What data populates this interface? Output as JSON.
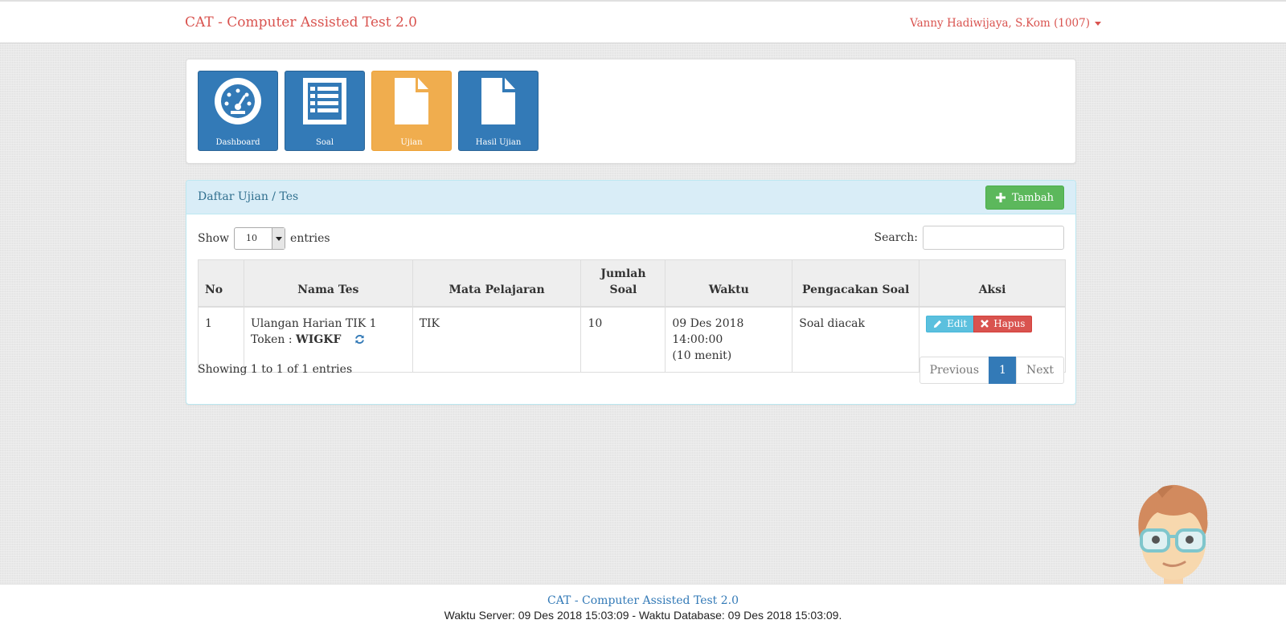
{
  "navbar": {
    "brand": "CAT - Computer Assisted Test 2.0",
    "user": "Vanny Hadiwijaya, S.Kom (1007)"
  },
  "menu": {
    "tiles": [
      {
        "label": "Dashboard",
        "icon": "dashboard-gauge-icon",
        "color": "#337ab7"
      },
      {
        "label": "Soal",
        "icon": "list-icon",
        "color": "#337ab7"
      },
      {
        "label": "Ujian",
        "icon": "file-icon",
        "color": "#f0ad4e",
        "active": true
      },
      {
        "label": "Hasil Ujian",
        "icon": "file-icon",
        "color": "#337ab7"
      }
    ]
  },
  "list_panel": {
    "title": "Daftar Ujian / Tes",
    "add_button": "Tambah",
    "show_label": "Show",
    "entries_value": "10",
    "entries_label": "entries",
    "search_label": "Search:",
    "search_value": "",
    "columns": [
      "No",
      "Nama Tes",
      "Mata Pelajaran",
      "Jumlah Soal",
      "Waktu",
      "Pengacakan Soal",
      "Aksi"
    ],
    "rows": [
      {
        "no": "1",
        "nama_tes": "Ulangan Harian TIK 1",
        "token_label": "Token : ",
        "token_value": "WIGKF",
        "mata_pelajaran": "TIK",
        "jumlah_soal": "10",
        "waktu": "09 Des 2018 14:00:00",
        "durasi": "(10 menit)",
        "pengacakan": "Soal diacak",
        "edit_label": "Edit",
        "hapus_label": "Hapus"
      }
    ],
    "info": "Showing 1 to 1 of 1 entries",
    "pagination": {
      "previous": "Previous",
      "current": "1",
      "next": "Next"
    }
  },
  "footer": {
    "title": "CAT - Computer Assisted Test 2.0",
    "time": "Waktu Server: 09 Des 2018 15:03:09 - Waktu Database: 09 Des 2018 15:03:09."
  },
  "colors": {
    "primary": "#337ab7",
    "warning": "#f0ad4e",
    "success": "#5cb85c",
    "danger": "#d9534f",
    "info": "#5bc0de"
  }
}
